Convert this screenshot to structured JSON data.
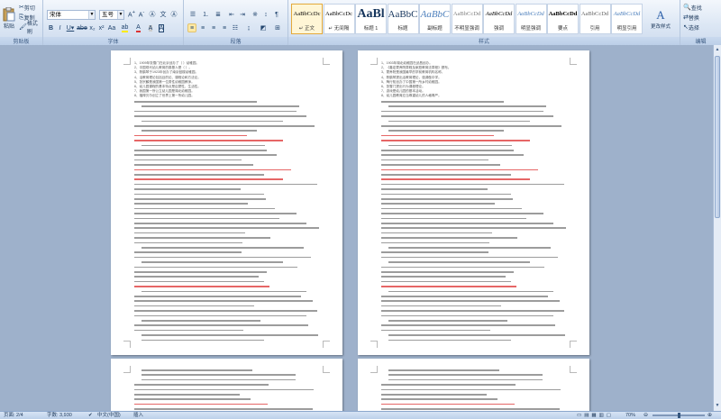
{
  "ribbon": {
    "clipboard": {
      "paste_label": "粘贴",
      "cut_label": "剪切",
      "copy_label": "复制",
      "format_painter_label": "格式刷",
      "group_label": "剪贴板"
    },
    "font": {
      "font_name": "宋体",
      "font_size": "五号",
      "group_label": "字体"
    },
    "paragraph": {
      "group_label": "段落"
    },
    "styles": {
      "group_label": "样式",
      "tiles": [
        {
          "sample": "AaBbCcDc",
          "name": "↵ 正文"
        },
        {
          "sample": "AaBbCcDc",
          "name": "↵ 无间隔"
        },
        {
          "sample": "AaBl",
          "name": "标题 1"
        },
        {
          "sample": "AaBbC",
          "name": "标题"
        },
        {
          "sample": "AaBbC",
          "name": "副标题"
        },
        {
          "sample": "AaBbCcDd",
          "name": "不明显强调"
        },
        {
          "sample": "AaBbCcDd",
          "name": "强调"
        },
        {
          "sample": "AaBbCcDd",
          "name": "明显强调"
        },
        {
          "sample": "AaBbCcDd",
          "name": "要点"
        },
        {
          "sample": "AaBbCcDd",
          "name": "引用"
        },
        {
          "sample": "AaBbCcDd",
          "name": "明显引用"
        }
      ],
      "change_styles_label": "更改样式"
    },
    "editing": {
      "find_label": "查找",
      "replace_label": "替换",
      "select_label": "选择",
      "group_label": "编辑"
    }
  },
  "document": {
    "left_page_text": [
      "1、1909年张雪门在北京创办了（ ）幼稚园。",
      "2、中国现代幼儿教育的奠基人是（ ）。",
      "3、陈鹤琴于1923年创办了南京鼓楼幼稚园。",
      "4、活教育理论包括目的论、课程论和方法论。",
      "5、张宗麟是我国第一位男性幼稚园教师。",
      "6、幼儿园课程的基本特点是启蒙性、生活性。",
      "7、我国第一所公立幼儿园是湖北幼稚园。",
      "8、福禄贝尔创立了世界上第一所幼儿园。"
    ],
    "right_page_text": [
      "1、1903年湖北幼稚园在武昌创办。",
      "2、《奏定蒙养院章程及家庭教育法章程》颁布。",
      "3、蒙养院是我国最早的学前教育机构名称。",
      "4、陈鹤琴提出活教育理论，强调做中学。",
      "5、陶行知创办了中国第一所乡村幼稚园。",
      "6、张雪门提出行为课程理论。",
      "7、游戏是幼儿园的基本活动。",
      "8、幼儿园教育应当尊重幼儿的人格尊严。"
    ]
  },
  "status_bar": {
    "page": "页面: 2/4",
    "words": "字数: 3,930",
    "language": "中文(中国)",
    "mode": "插入",
    "zoom": "70%"
  },
  "colors": {
    "highlight": "#d33333",
    "ribbon_blue": "#1e395b"
  }
}
